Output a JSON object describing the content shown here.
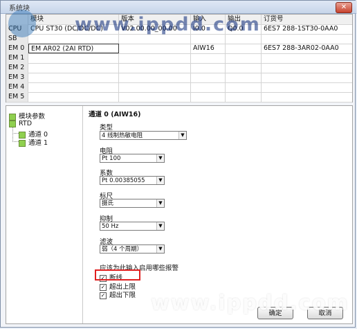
{
  "window": {
    "title": "系统块"
  },
  "table": {
    "headers": [
      "",
      "模块",
      "版本",
      "输入",
      "输出",
      "订货号"
    ],
    "rows": [
      {
        "slot": "CPU",
        "module": "CPU ST30 (DC/DC/DC)",
        "version": "V02.00.00_00.00",
        "input": "I0.0",
        "output": "Q0.0",
        "order": "6ES7 288-1ST30-0AA0"
      },
      {
        "slot": "SB",
        "module": "",
        "version": "",
        "input": "",
        "output": "",
        "order": ""
      },
      {
        "slot": "EM 0",
        "module": "EM AR02 (2AI RTD)",
        "version": "",
        "input": "AIW16",
        "output": "",
        "order": "6ES7 288-3AR02-0AA0"
      },
      {
        "slot": "EM 1",
        "module": "",
        "version": "",
        "input": "",
        "output": "",
        "order": ""
      },
      {
        "slot": "EM 2",
        "module": "",
        "version": "",
        "input": "",
        "output": "",
        "order": ""
      },
      {
        "slot": "EM 3",
        "module": "",
        "version": "",
        "input": "",
        "output": "",
        "order": ""
      },
      {
        "slot": "EM 4",
        "module": "",
        "version": "",
        "input": "",
        "output": "",
        "order": ""
      },
      {
        "slot": "EM 5",
        "module": "",
        "version": "",
        "input": "",
        "output": "",
        "order": ""
      }
    ]
  },
  "tree": {
    "root": "模块参数",
    "group": "RTD",
    "children": [
      "通道 0",
      "通道 1"
    ]
  },
  "panel": {
    "heading": "通道 0 (AIW16)",
    "type_label": "类型",
    "type_value": "4 线制热敏电阻",
    "resistor_label": "电阻",
    "resistor_value": "Pt 100",
    "coef_label": "系数",
    "coef_value": "Pt 0.00385055",
    "scale_label": "标尺",
    "scale_value": "摄氏",
    "reject_label": "抑制",
    "reject_value": "50 Hz",
    "filter_label": "滤波",
    "filter_value": "弱（4 个周期）",
    "alarm_label": "应该为此输入启用哪些报警",
    "alarms": [
      {
        "label": "断线",
        "checked": true
      },
      {
        "label": "超出上限",
        "checked": true
      },
      {
        "label": "超出下限",
        "checked": true
      }
    ],
    "check_mark": "✓",
    "arrow": "▼"
  },
  "buttons": {
    "ok": "确定",
    "cancel": "取消"
  },
  "watermarks": {
    "top": "www.ippdd.com",
    "bottom": "www.ippdd.com"
  },
  "colors": {
    "highlight": "#e02020",
    "tree_box": "#8fd04f"
  }
}
